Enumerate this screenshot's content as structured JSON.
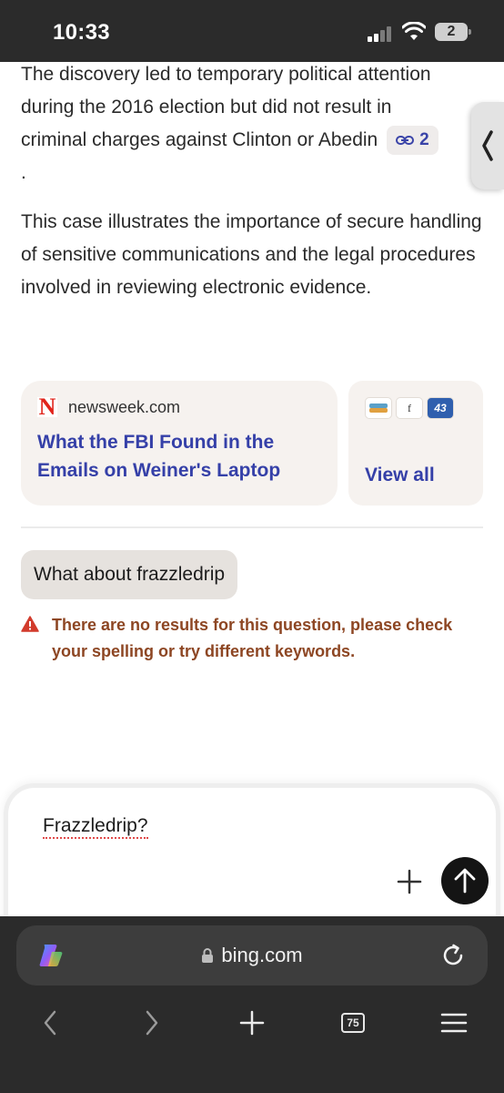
{
  "status_bar": {
    "time": "10:33",
    "battery_label": "2"
  },
  "answer": {
    "para1_lines": [
      "The discovery led to temporary political attention",
      "during the 2016 election but did not result in",
      "criminal charges against Clinton or Abedin"
    ],
    "citation_count": "2",
    "trailing_dot": ".",
    "para2": "This case illustrates the importance of secure handling of sensitive communications and the legal procedures involved in reviewing electronic evidence."
  },
  "source_card": {
    "logo_letter": "N",
    "domain": "newsweek.com",
    "title": "What the FBI Found in the Emails on Weiner's Laptop"
  },
  "view_all": {
    "label": "View all",
    "mini_icons": [
      "stack-icon",
      "f",
      "43"
    ]
  },
  "conversation": {
    "user_message": "What about frazzledrip",
    "error_message": "There are no results for this question, please check your spelling or try different keywords."
  },
  "composer": {
    "text": "Frazzledrip?"
  },
  "browser": {
    "url": "bing.com",
    "tab_count": "75"
  },
  "colors": {
    "link_blue": "#3540a8",
    "error_brown": "#8d4623",
    "warning_red": "#d23b2c",
    "card_bg": "#f6f2ef",
    "chrome_bg": "#2b2b2b"
  }
}
